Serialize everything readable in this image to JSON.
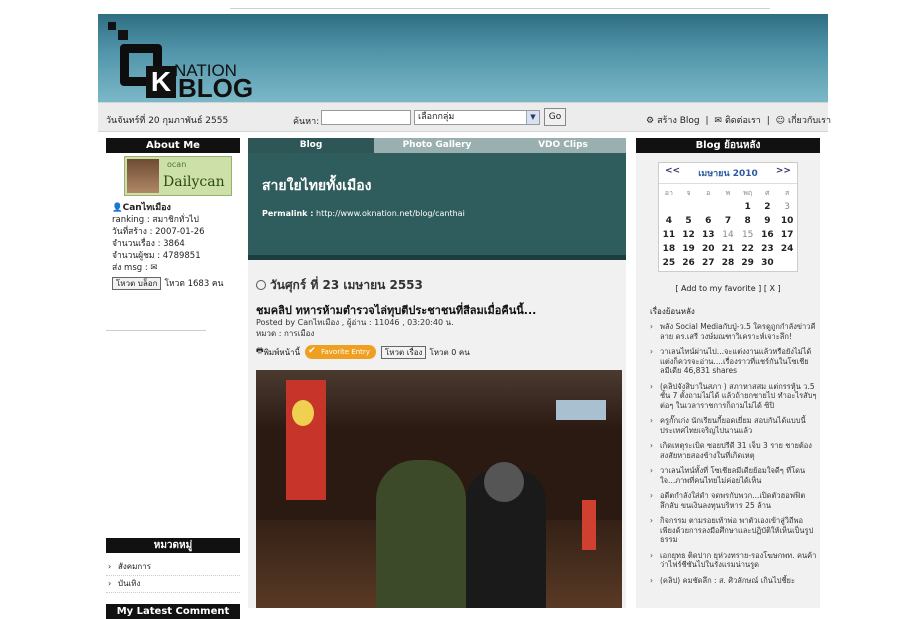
{
  "header": {
    "logo_nation": "NATION",
    "logo_k": "K",
    "logo_blog": "BLOG"
  },
  "nav": {
    "date": "วันจันทร์ที่ 20 กุมภาพันธ์ 2555",
    "search_label": "ค้นหา:",
    "search_value": "",
    "group_select": "เลือกกลุ่ม",
    "go_label": "Go",
    "create_blog": "สร้าง Blog",
    "contact": "ติดต่อเรา",
    "about": "เกี่ยวกับเรา"
  },
  "about": {
    "heading": "About Me",
    "avatar_small": "ocan",
    "avatar_name": "Dailycan",
    "username": "Canไทเมือง",
    "ranking": "ranking : สมาชิกทั่วไป",
    "created": "วันที่สร้าง : 2007-01-26",
    "stories": "จำนวนเรื่อง : 3864",
    "visitors": "จำนวนผู้ชม : 4789851",
    "msg": "ส่ง msg :",
    "vote_button": "โหวต บล็อก",
    "vote_count": "โหวต 1683 คน"
  },
  "categories": {
    "heading": "หมวดหมู่",
    "items": [
      "สังคมการ",
      "บันเทิง"
    ]
  },
  "latest_comment": {
    "heading": "My Latest Comment"
  },
  "tabs": [
    {
      "label": "Blog"
    },
    {
      "label": "Photo Gallery"
    },
    {
      "label": "VDO Clips"
    }
  ],
  "banner": {
    "title": "สายใยไทยทั้งเมือง",
    "permalink_label": "Permalink :",
    "permalink_url": "http://www.oknation.net/blog/canthai"
  },
  "post": {
    "date": "วันศุกร์ ที่ 23 เมษายน 2553",
    "title": "ชมคลิป ทหารห้ามตำรวจไล่ทุบตีประชาชนที่สีลมเมื่อคืนนี้...",
    "posted_by": "Posted by Canไทเมือง , ผู้อ่าน : 11046 , 03:20:40 น.",
    "category": "หมวด : การเมือง",
    "print": "พิมพ์หน้านี้",
    "favorite": "Favorite Entry",
    "vote_button": "โหวต เรื่อง",
    "vote_count": "โหวต 0 คน"
  },
  "right": {
    "heading": "Blog ย้อนหลัง",
    "cal_prev": "<<",
    "cal_month": "เมษายน 2010",
    "cal_next": ">>",
    "weekdays": [
      "อา",
      "จ",
      "อ",
      "พ",
      "พฤ",
      "ศ",
      "ส"
    ],
    "weeks": [
      [
        "",
        "",
        "",
        "",
        "1",
        "2",
        "3"
      ],
      [
        "4",
        "5",
        "6",
        "7",
        "8",
        "9",
        "10"
      ],
      [
        "11",
        "12",
        "13",
        "14",
        "15",
        "16",
        "17"
      ],
      [
        "18",
        "19",
        "20",
        "21",
        "22",
        "23",
        "24"
      ],
      [
        "25",
        "26",
        "27",
        "28",
        "29",
        "30",
        ""
      ]
    ],
    "add_favorite": "[ Add to my favorite ] [ X ]",
    "list_title": "เรื่องย้อนหลัง",
    "items": [
      "พลัง Social Mediaกับปู่-ว.5 ใครดูถูกกำลังข่าวคีลาย ดร.เสรี วงษ์มณฑาวิเคราะห์เจาะลึก!",
      "วาเลนไทน์ผ่านไป...จะแต่งงานแล้วหรือยังไม่ได้แต่งก็ควรจะอ่าน....เรื่องราวที่แชร์กันในโซเชียลมีเดีย 46,831 shares",
      "(คลิปจังสิบาในสภา ) สภาหาสสม แต่กรรหุ้น ว.5 ชั้น 7 ตั้งถามไม่ได้ แล้วถ้ายกชายไป ทำอะไรสับๆ ต่อๆ ในเวลาราชการก็ถามไม่ได้ ซิปิ",
      "ครูกั๊กเก่ง นักเรียนกี้ยอดเยี่ยม สอบกันได้แบบนี้ ประเทศไทยเจริญไปนานแล้ว",
      "เกิดเหตุระเบิด ซอยปรีดี 31 เจ็บ 3 ราย ชายต้องสงสัยหายสองข้างในที่เกิดเหตุ",
      "วาเลนไทน์ทั้งที่ โซเชียลมีเดียย้อมใจดีๆ ที่โดนใจ...ภาพที่คนไทยไม่ค่อยได้เห็น",
      "อดีตกำลังใส่ดำ จดพรกับพวก...เปิดตัวฮอฟฟิตลึกลับ ขนเงินลงทุนบริหาร 25 ล้าน",
      "กิจกรรม ตามรอยเท้าพ่อ พาตัวเองเข้าสู่วิถีพอเพียงด้วยการลงมือศึกษาและปฏิบัติให้เห็นเป็นรูปธรรม",
      "เอกยุทธ ติดปาก ยุห่วงทราย-รองโฆษกพท. คนค้าว่าไฟร์ชีซันไปในรังแรมน่านรูด",
      "(คลิป) คมชัดลึก : ส. ศิวลักษณ์ เกินไปชี้ยะ"
    ]
  }
}
